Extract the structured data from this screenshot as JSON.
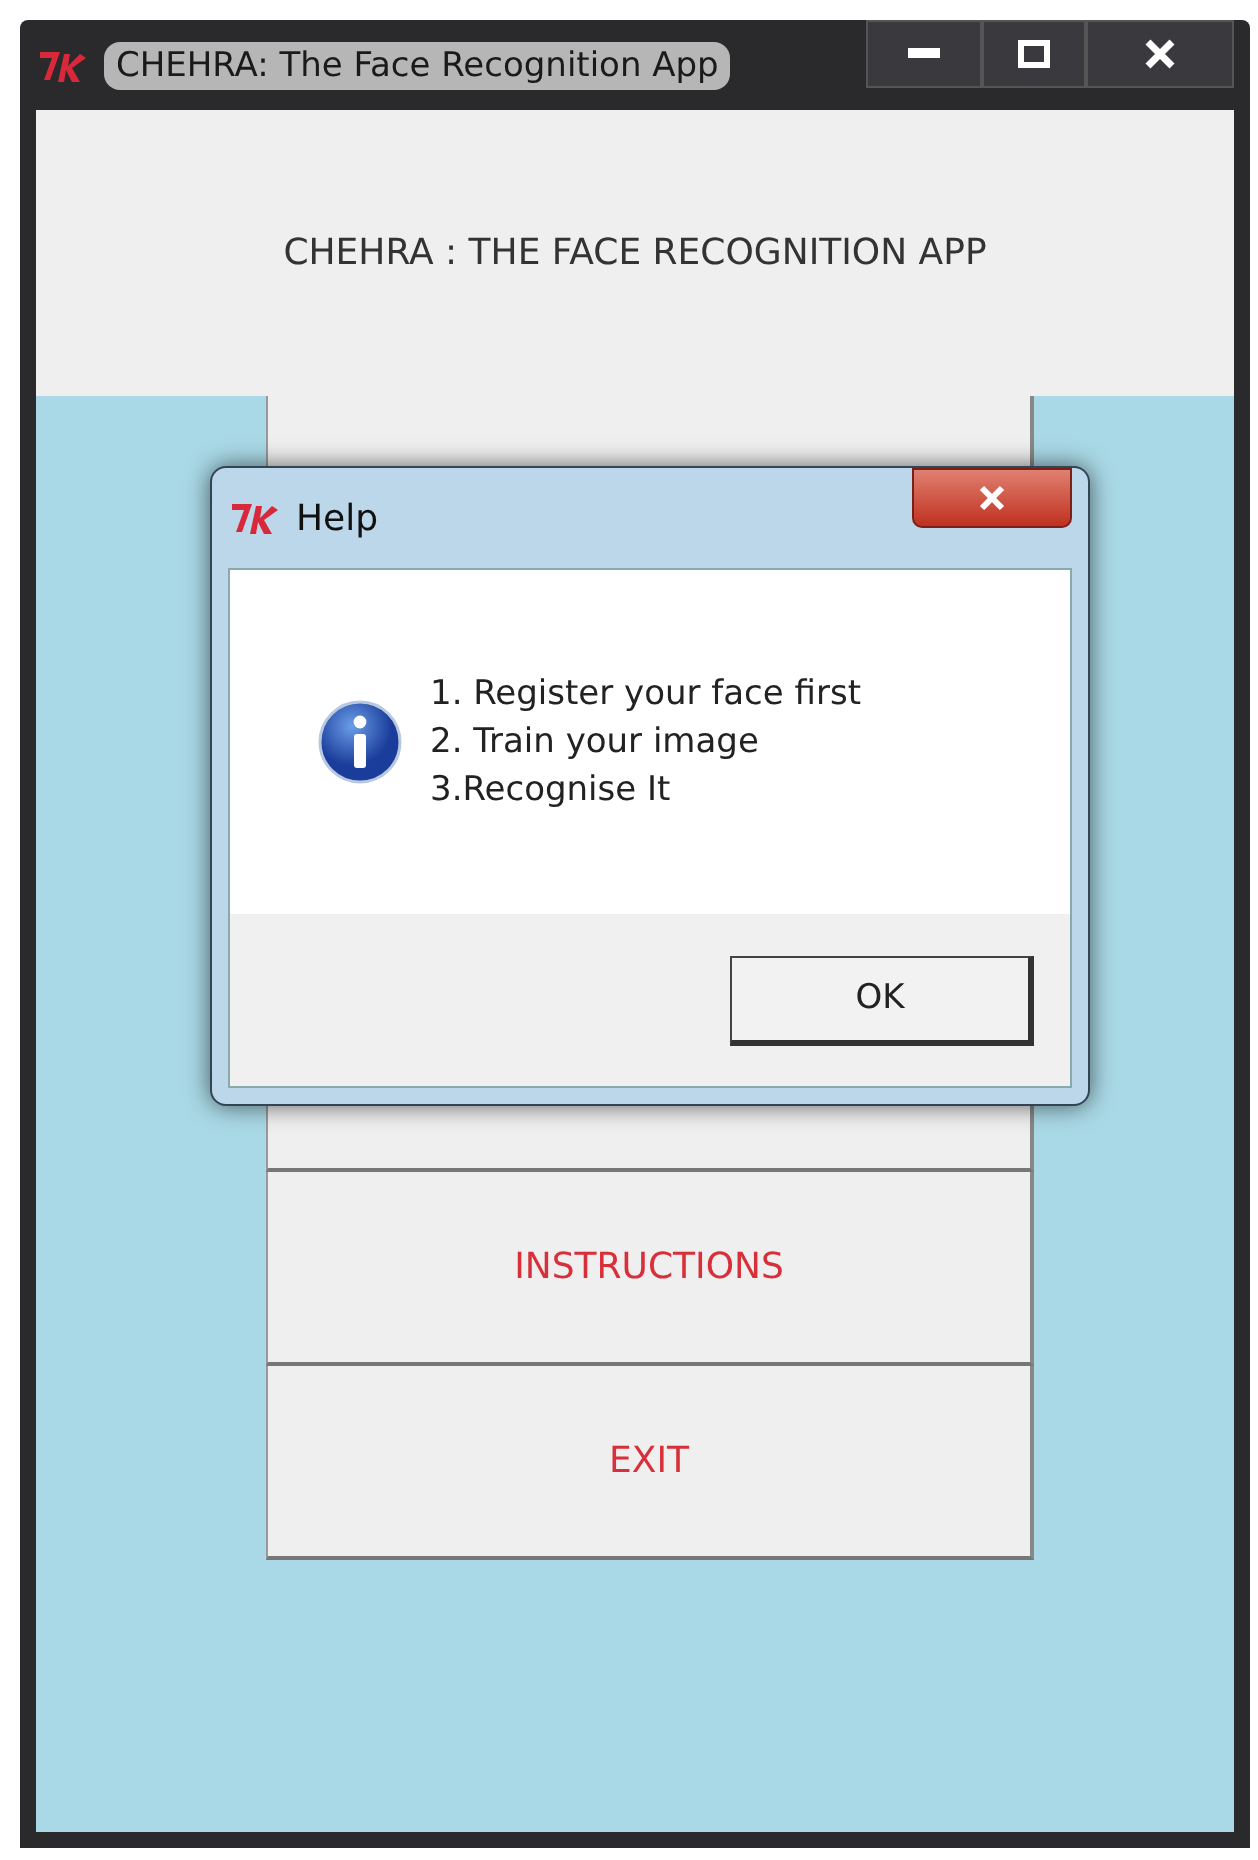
{
  "window": {
    "title": "CHEHRA: The Face Recognition App"
  },
  "header": {
    "title": "CHEHRA : THE FACE RECOGNITION APP"
  },
  "menu_buttons": [
    {
      "kind": "covered"
    },
    {
      "kind": "covered"
    },
    {
      "kind": "text",
      "label": "INSTRUCTIONS"
    },
    {
      "kind": "text",
      "label": "EXIT"
    }
  ],
  "dialog": {
    "title": "Help",
    "message_lines": [
      "1. Register your face first",
      "2. Train your image",
      "3.Recognise It"
    ],
    "buttons": [
      "OK"
    ]
  }
}
